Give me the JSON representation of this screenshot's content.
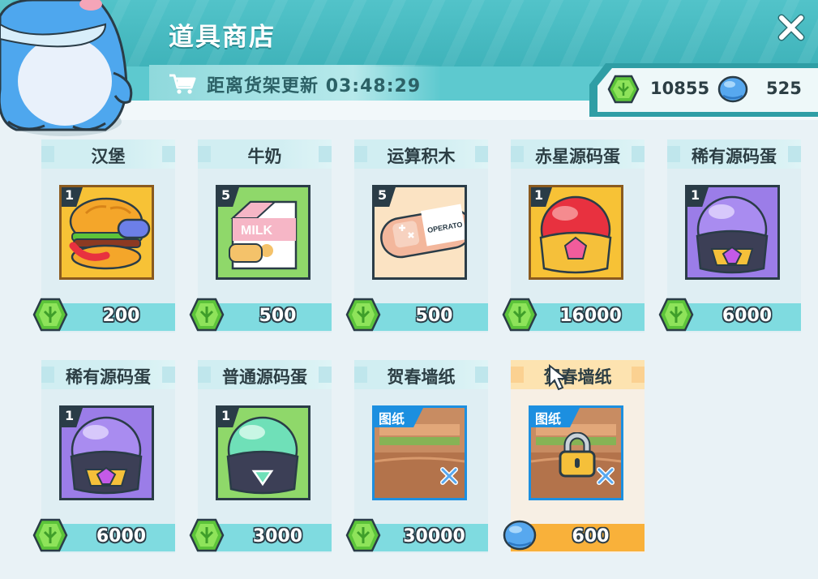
{
  "header": {
    "title": "道具商店",
    "refresh_label": "距离货架更新",
    "refresh_time": "03:48:29"
  },
  "currency": {
    "gems": "10855",
    "coins": "525"
  },
  "items": [
    {
      "name": "汉堡",
      "qty": "1",
      "price": "200",
      "currency_icon": "green-gem-icon",
      "bg": "#f7c236"
    },
    {
      "name": "牛奶",
      "qty": "5",
      "price": "500",
      "currency_icon": "green-gem-icon",
      "bg": "#8fd86a"
    },
    {
      "name": "运算积木",
      "qty": "5",
      "price": "500",
      "currency_icon": "green-gem-icon",
      "bg": "#fbe3c3"
    },
    {
      "name": "赤星源码蛋",
      "qty": "1",
      "price": "16000",
      "currency_icon": "green-gem-icon",
      "bg": "#f7c236"
    },
    {
      "name": "稀有源码蛋",
      "qty": "1",
      "price": "6000",
      "currency_icon": "green-gem-icon",
      "bg": "#9b7de8"
    },
    {
      "name": "稀有源码蛋",
      "qty": "1",
      "price": "6000",
      "currency_icon": "green-gem-icon",
      "bg": "#9b7de8"
    },
    {
      "name": "普通源码蛋",
      "qty": "1",
      "price": "3000",
      "currency_icon": "green-gem-icon",
      "bg": "#8fd86a"
    },
    {
      "name": "贺春墙纸",
      "tag": "图纸",
      "price": "30000",
      "currency_icon": "green-gem-icon",
      "bg": "#b98a5e"
    },
    {
      "name": "贺春墙纸",
      "tag": "图纸",
      "price": "600",
      "currency_icon": "blue-coin-icon",
      "bg": "#b98a5e",
      "locked": true
    }
  ]
}
